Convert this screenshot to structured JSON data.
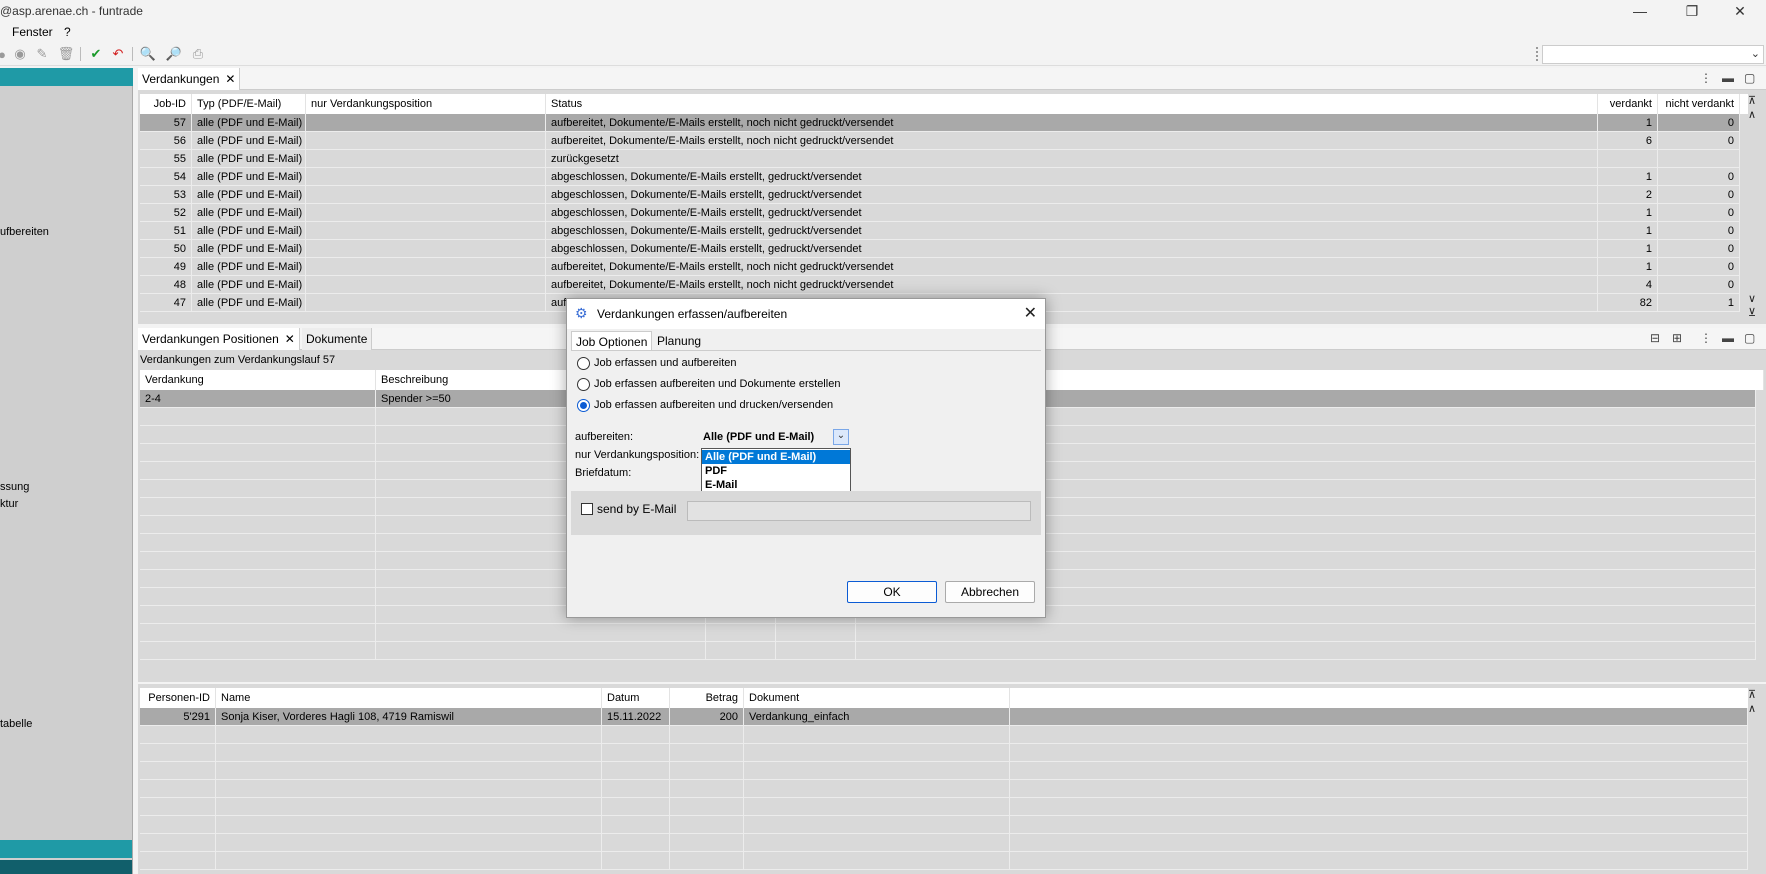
{
  "window": {
    "title": "@asp.arenae.ch - funtrade"
  },
  "menu": {
    "items": [
      "Fenster",
      "?"
    ]
  },
  "sidebar": {
    "items": [
      {
        "label": "ufbereiten",
        "top": 0
      },
      {
        "label": "ssung",
        "top": 0
      },
      {
        "label": "ktur",
        "top": 0
      },
      {
        "label": "tabelle",
        "top": 0
      }
    ]
  },
  "top_panel": {
    "tab": "Verdankungen",
    "columns": [
      "Job-ID",
      "Typ (PDF/E-Mail)",
      "nur Verdankungsposition",
      "Status",
      "verdankt",
      "nicht verdankt"
    ],
    "rows": [
      [
        "57",
        "alle (PDF und E-Mail)",
        "",
        "aufbereitet, Dokumente/E-Mails erstellt, noch nicht gedruckt/versendet",
        "1",
        "0"
      ],
      [
        "56",
        "alle (PDF und E-Mail)",
        "",
        "aufbereitet, Dokumente/E-Mails erstellt, noch nicht gedruckt/versendet",
        "6",
        "0"
      ],
      [
        "55",
        "alle (PDF und E-Mail)",
        "",
        "zurückgesetzt",
        "",
        ""
      ],
      [
        "54",
        "alle (PDF und E-Mail)",
        "",
        "abgeschlossen, Dokumente/E-Mails erstellt, gedruckt/versendet",
        "1",
        "0"
      ],
      [
        "53",
        "alle (PDF und E-Mail)",
        "",
        "abgeschlossen, Dokumente/E-Mails erstellt, gedruckt/versendet",
        "2",
        "0"
      ],
      [
        "52",
        "alle (PDF und E-Mail)",
        "",
        "abgeschlossen, Dokumente/E-Mails erstellt, gedruckt/versendet",
        "1",
        "0"
      ],
      [
        "51",
        "alle (PDF und E-Mail)",
        "",
        "abgeschlossen, Dokumente/E-Mails erstellt, gedruckt/versendet",
        "1",
        "0"
      ],
      [
        "50",
        "alle (PDF und E-Mail)",
        "",
        "abgeschlossen, Dokumente/E-Mails erstellt, gedruckt/versendet",
        "1",
        "0"
      ],
      [
        "49",
        "alle (PDF und E-Mail)",
        "",
        "aufbereitet, Dokumente/E-Mails erstellt, noch nicht gedruckt/versendet",
        "1",
        "0"
      ],
      [
        "48",
        "alle (PDF und E-Mail)",
        "",
        "aufbereitet, Dokumente/E-Mails erstellt, noch nicht gedruckt/versendet",
        "4",
        "0"
      ],
      [
        "47",
        "alle (PDF und E-Mail)",
        "",
        "aufb",
        "82",
        "1"
      ]
    ]
  },
  "mid_panel": {
    "tabs": [
      "Verdankungen Positionen",
      "Dokumente"
    ],
    "caption": "Verdankungen zum Verdankungslauf 57",
    "columns": [
      "Verdankung",
      "Beschreibung"
    ],
    "rows": [
      [
        "2-4",
        "Spender >=50"
      ]
    ]
  },
  "bottom_panel": {
    "columns": [
      "Personen-ID",
      "Name",
      "Datum",
      "Betrag",
      "Dokument"
    ],
    "rows": [
      [
        "5'291",
        "Sonja Kiser, Vorderes Hagli 108, 4719 Ramiswil",
        "15.11.2022",
        "200",
        "Verdankung_einfach"
      ]
    ]
  },
  "dialog": {
    "title": "Verdankungen erfassen/aufbereiten",
    "tabs": [
      "Job Optionen",
      "Planung"
    ],
    "radios": [
      {
        "label": "Job erfassen und aufbereiten",
        "checked": false
      },
      {
        "label": "Job erfassen aufbereiten und Dokumente erstellen",
        "checked": false
      },
      {
        "label": "Job erfassen aufbereiten und drucken/versenden",
        "checked": true
      }
    ],
    "fields": {
      "aufbereiten": "aufbereiten:",
      "nur_pos": "nur Verdankungsposition:",
      "briefdatum": "Briefdatum:"
    },
    "combo_value": "Alle (PDF und E-Mail)",
    "options": [
      "Alle (PDF und E-Mail)",
      "PDF",
      "E-Mail"
    ],
    "email_label": "send by E-Mail",
    "ok": "OK",
    "cancel": "Abbrechen"
  },
  "colors": {
    "accent": "#1f9aa6",
    "selection": "#0078d7"
  }
}
